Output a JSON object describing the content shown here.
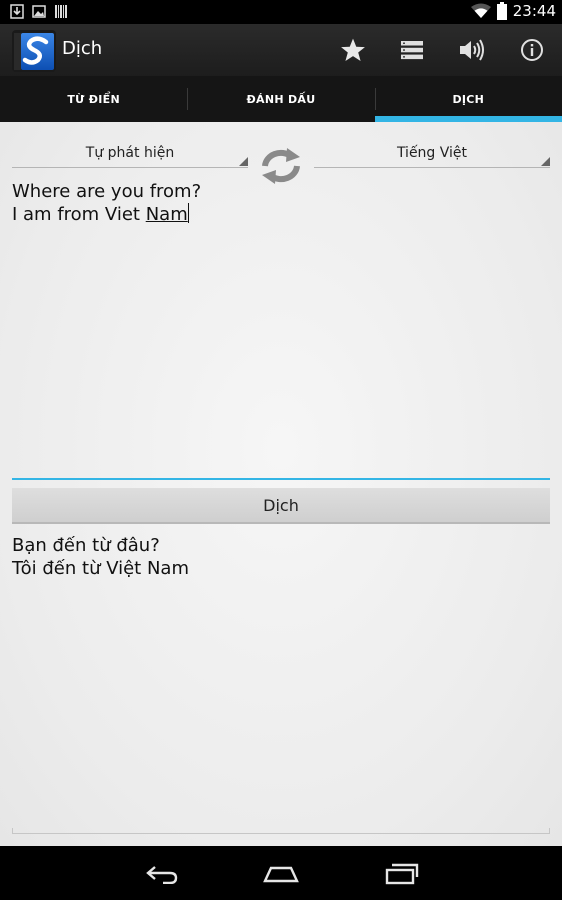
{
  "status_bar": {
    "time": "23:44",
    "icons": [
      "download-icon",
      "image-icon",
      "barcode-icon",
      "wifi-icon",
      "battery-icon"
    ]
  },
  "action_bar": {
    "title": "Dịch",
    "app_icon": "dictionary-app-icon",
    "actions": [
      "star-icon",
      "list-icon",
      "speaker-icon",
      "info-icon"
    ]
  },
  "tabs": [
    {
      "label": "TỪ ĐIỂN",
      "active": false
    },
    {
      "label": "ĐÁNH DẤU",
      "active": false
    },
    {
      "label": "DỊCH",
      "active": true
    }
  ],
  "translator": {
    "source_lang": "Tự phát hiện",
    "target_lang": "Tiếng Việt",
    "swap_icon": "swap-icon",
    "source_text": {
      "line1": "Where are you from?",
      "line2_prefix": "I am from Viet ",
      "line2_word": "Nam"
    },
    "translate_label": "Dịch",
    "result": {
      "line1": "Bạn đến từ đâu?",
      "line2": "Tôi đến từ Việt Nam"
    }
  },
  "nav_bar": {
    "buttons": [
      "back-icon",
      "home-icon",
      "recent-apps-icon"
    ]
  },
  "colors": {
    "accent": "#33b5e5",
    "action_bar": "#222222",
    "tab_bar": "#151515",
    "content_bg": "#efefef"
  }
}
